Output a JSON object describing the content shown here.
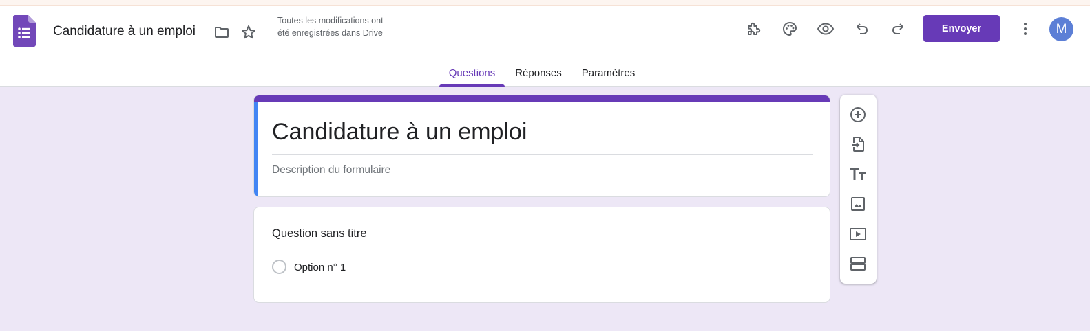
{
  "app": {
    "doc_title": "Candidature à un emploi",
    "save_status": "Toutes les modifications ont été enregistrées dans Drive",
    "send_label": "Envoyer",
    "avatar_initial": "M",
    "accent_color": "#673ab7"
  },
  "header_icons": [
    "forms-logo-icon",
    "folder-icon",
    "star-icon",
    "addon-puzzle-icon",
    "palette-icon",
    "preview-eye-icon",
    "undo-icon",
    "redo-icon",
    "more-vert-icon"
  ],
  "tabs": [
    {
      "label": "Questions",
      "active": true
    },
    {
      "label": "Réponses",
      "active": false
    },
    {
      "label": "Paramètres",
      "active": false
    }
  ],
  "form": {
    "title": "Candidature à un emploi",
    "description_placeholder": "Description du formulaire"
  },
  "question": {
    "title": "Question sans titre",
    "options": [
      "Option n° 1"
    ]
  },
  "toolbar_icons": [
    "add-question-icon",
    "import-questions-icon",
    "add-title-icon",
    "add-image-icon",
    "add-video-icon",
    "add-section-icon"
  ]
}
